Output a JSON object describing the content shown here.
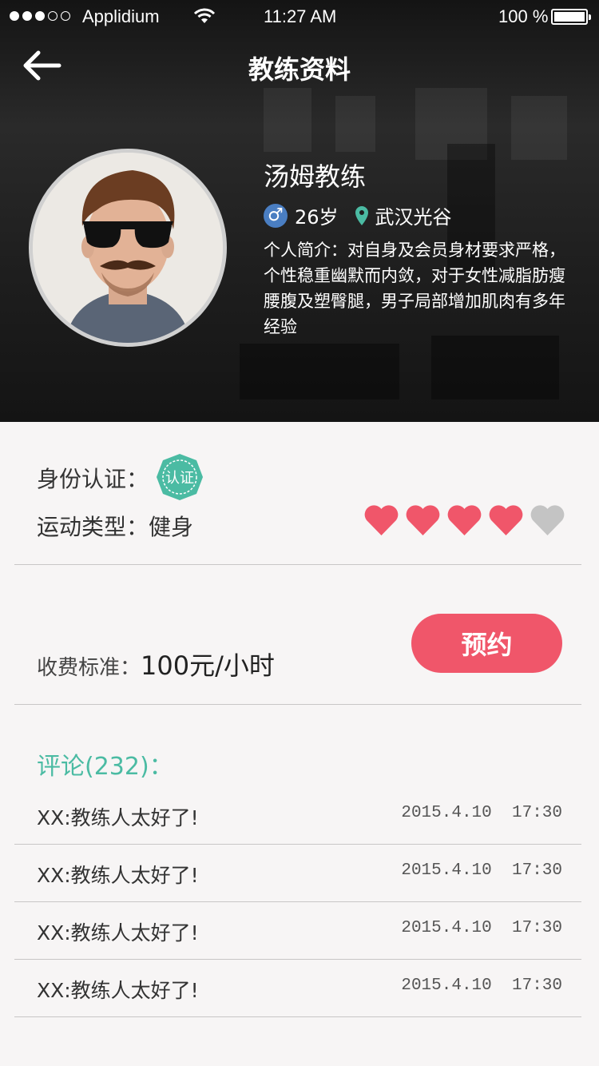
{
  "status_bar": {
    "carrier": "Applidium",
    "time": "11:27 AM",
    "battery": "100 %",
    "signal_dots_filled": 3,
    "signal_dots_total": 5,
    "battery_level": 1.0
  },
  "nav": {
    "title": "教练资料",
    "back_icon": "arrow-left-icon"
  },
  "profile": {
    "name": "汤姆教练",
    "gender_icon": "male-icon",
    "age": "26岁",
    "location_icon": "location-pin-icon",
    "location": "武汉光谷",
    "bio": "个人简介：对自身及会员身材要求严格，个性稳重幽默而内敛，对于女性减脂肪瘦腰腹及塑臀腿，男子局部增加肌肉有多年经验"
  },
  "details": {
    "verify_label": "身份认证：",
    "verify_badge": "认证",
    "sport_label": "运动类型：健身",
    "rating": 4,
    "rating_max": 5,
    "heart_color": "#f0566a",
    "heart_empty_color": "#c4c4c4"
  },
  "booking": {
    "fee_label": "收费标准：",
    "fee_value": "100元/小时",
    "button_label": "预约",
    "accent_color": "#f0566a"
  },
  "reviews": {
    "title": "评论(232)：",
    "title_color": "#4bbba3",
    "items": [
      {
        "text": "XX:教练人太好了!",
        "date": "2015.4.10",
        "time": "17:30"
      },
      {
        "text": "XX:教练人太好了!",
        "date": "2015.4.10",
        "time": "17:30"
      },
      {
        "text": "XX:教练人太好了!",
        "date": "2015.4.10",
        "time": "17:30"
      },
      {
        "text": "XX:教练人太好了!",
        "date": "2015.4.10",
        "time": "17:30"
      }
    ]
  }
}
